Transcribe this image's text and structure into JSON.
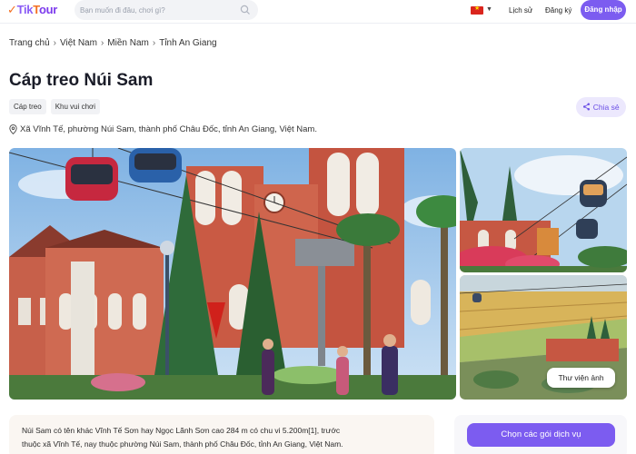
{
  "header": {
    "logo_t1": "Tik",
    "logo_t2": "T",
    "logo_t3": "our",
    "search_placeholder": "Bạn muốn đi đâu, chơi gì?",
    "history_label": "Lịch sử",
    "register_label": "Đăng ký",
    "login_label": "Đăng nhập"
  },
  "breadcrumb": [
    "Trang chủ",
    "Việt Nam",
    "Miền Nam",
    "Tỉnh An Giang"
  ],
  "breadcrumb_sep": "›",
  "title": "Cáp treo Núi Sam",
  "tags": [
    "Cáp treo",
    "Khu vui chơi"
  ],
  "share_label": "Chia sẻ",
  "address": "Xã Vĩnh Tế, phường Núi Sam, thành phố Châu Đốc, tỉnh An Giang, Việt Nam.",
  "gallery_button": "Thư viện ảnh",
  "description_line1": "Núi Sam có tên khác Vĩnh Tế Sơn hay Ngọc Lãnh Sơn cao 284 m có chu vi 5.200m[1], trước",
  "description_line2": "thuộc xã Vĩnh Tế, nay thuộc phường Núi Sam, thành phố Châu Đốc, tỉnh An Giang, Việt Nam.",
  "service_button": "Chọn các gói dịch vụ",
  "colors": {
    "accent": "#7c5cf0",
    "brand_orange": "#f36f21"
  }
}
